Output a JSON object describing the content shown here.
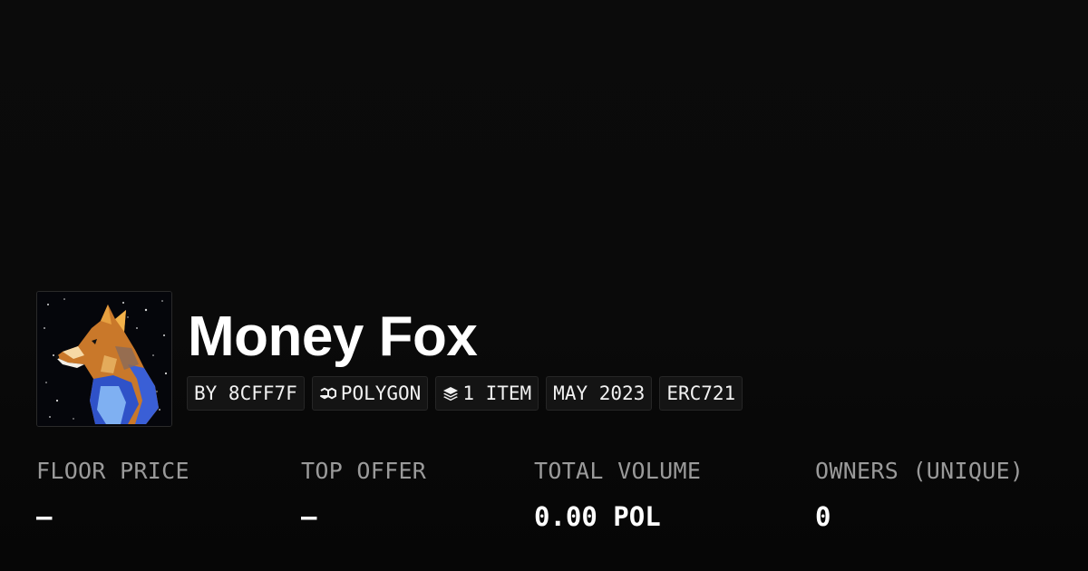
{
  "collection": {
    "name": "Money Fox",
    "avatar_alt": "fox painting"
  },
  "tags": [
    {
      "label": "BY 8CFF7F",
      "icon": ""
    },
    {
      "label": "POLYGON",
      "icon": "polygon-chain-icon"
    },
    {
      "label": "1 ITEM",
      "icon": "layers-icon"
    },
    {
      "label": "MAY 2023",
      "icon": ""
    },
    {
      "label": "ERC721",
      "icon": ""
    }
  ],
  "stats": [
    {
      "label": "FLOOR PRICE",
      "value": "–"
    },
    {
      "label": "TOP OFFER",
      "value": "–"
    },
    {
      "label": "TOTAL VOLUME",
      "value": "0.00 POL"
    },
    {
      "label": "OWNERS (UNIQUE)",
      "value": "0"
    }
  ],
  "colors": {
    "background": "#0a0a0a",
    "tag_background": "#141414",
    "label_gray": "#9a9a9a"
  }
}
